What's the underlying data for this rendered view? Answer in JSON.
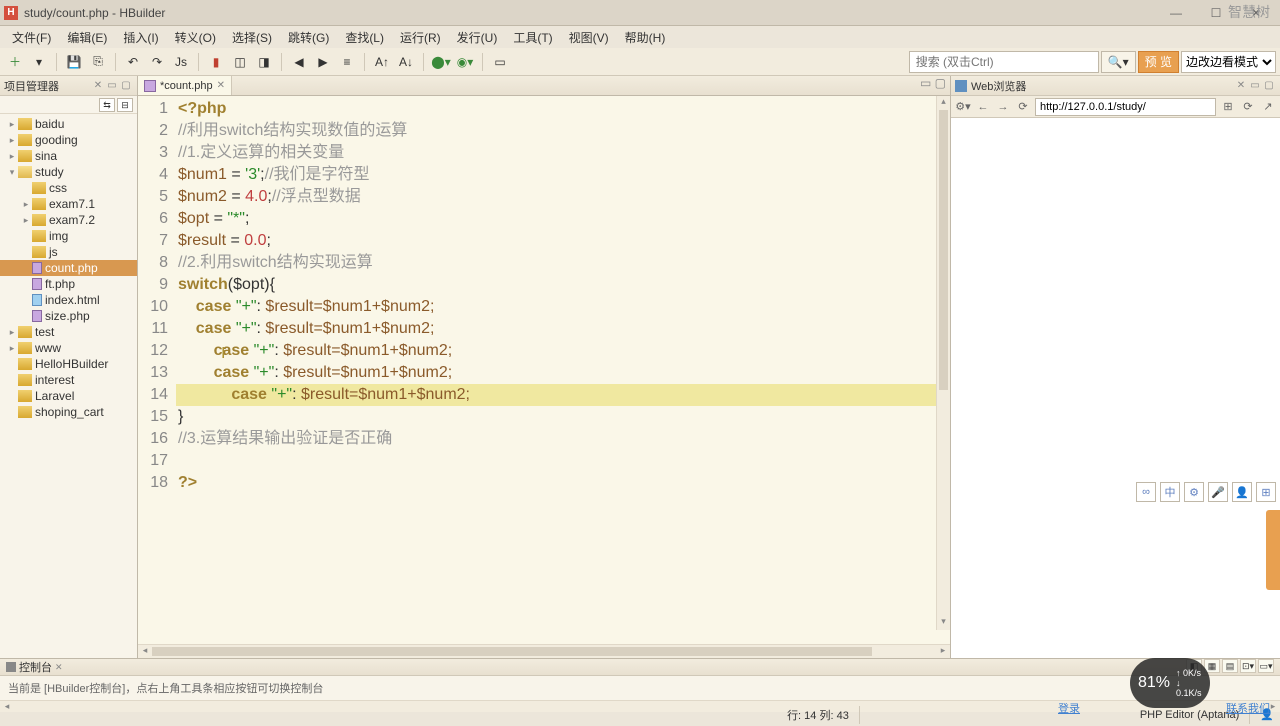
{
  "window": {
    "title": "study/count.php - HBuilder",
    "app_icon": "H",
    "watermark": "智慧树"
  },
  "menu": [
    "文件(F)",
    "编辑(E)",
    "插入(I)",
    "转义(O)",
    "选择(S)",
    "跳转(G)",
    "查找(L)",
    "运行(R)",
    "发行(U)",
    "工具(T)",
    "视图(V)",
    "帮助(H)"
  ],
  "toolbar": {
    "search_placeholder": "搜索 (双击Ctrl)",
    "preview_label": "预 览",
    "mode_label": "边改边看模式"
  },
  "project_manager": {
    "title": "项目管理器",
    "tree": [
      {
        "depth": 0,
        "exp": ">",
        "icon": "folder",
        "label": "baidu"
      },
      {
        "depth": 0,
        "exp": ">",
        "icon": "folder",
        "label": "gooding"
      },
      {
        "depth": 0,
        "exp": ">",
        "icon": "folder",
        "label": "sina"
      },
      {
        "depth": 0,
        "exp": "v",
        "icon": "folder-open",
        "label": "study"
      },
      {
        "depth": 1,
        "exp": " ",
        "icon": "folder",
        "label": "css"
      },
      {
        "depth": 1,
        "exp": ">",
        "icon": "folder",
        "label": "exam7.1"
      },
      {
        "depth": 1,
        "exp": ">",
        "icon": "folder",
        "label": "exam7.2"
      },
      {
        "depth": 1,
        "exp": " ",
        "icon": "folder",
        "label": "img"
      },
      {
        "depth": 1,
        "exp": " ",
        "icon": "folder",
        "label": "js"
      },
      {
        "depth": 1,
        "exp": " ",
        "icon": "php-ic",
        "label": "count.php",
        "selected": true
      },
      {
        "depth": 1,
        "exp": " ",
        "icon": "php-ic",
        "label": "ft.php"
      },
      {
        "depth": 1,
        "exp": " ",
        "icon": "html-ic",
        "label": "index.html"
      },
      {
        "depth": 1,
        "exp": " ",
        "icon": "php-ic",
        "label": "size.php"
      },
      {
        "depth": 0,
        "exp": ">",
        "icon": "folder",
        "label": "test"
      },
      {
        "depth": 0,
        "exp": ">",
        "icon": "folder",
        "label": "www"
      },
      {
        "depth": 0,
        "exp": " ",
        "icon": "folder",
        "label": "HelloHBuilder"
      },
      {
        "depth": 0,
        "exp": " ",
        "icon": "folder",
        "label": "interest"
      },
      {
        "depth": 0,
        "exp": " ",
        "icon": "folder",
        "label": "Laravel"
      },
      {
        "depth": 0,
        "exp": " ",
        "icon": "folder",
        "label": "shoping_cart"
      }
    ]
  },
  "editor": {
    "tab_label": "*count.php",
    "lines": 18,
    "code": {
      "l1": "<?php",
      "l2_c": "//利用switch结构实现数值的运算",
      "l3_c": "//1.定义运算的相关变量",
      "l4_var": "$num1",
      "l4_eq": " = ",
      "l4_str": "'3'",
      "l4_semi": ";",
      "l4_c": "//我们是字符型",
      "l5_var": "$num2",
      "l5_eq": " = ",
      "l5_num": "4.0",
      "l5_semi": ";",
      "l5_c": "//浮点型数据",
      "l6_var": "$opt",
      "l6_eq": " = ",
      "l6_str": "\"*\"",
      "l6_semi": ";",
      "l7_var": "$result",
      "l7_eq": " = ",
      "l7_num": "0.0",
      "l7_semi": ";",
      "l8_c": "//2.利用switch结构实现运算",
      "l9_kw": "switch",
      "l9_rest": "($opt){",
      "case_kw": "case",
      "case_str": "\"+\"",
      "colon": ": ",
      "assign": "$result=$num1+$num2;",
      "l15": "}",
      "l16_c": "//3.运算结果输出验证是否正确",
      "l18": "?>"
    }
  },
  "web_browser": {
    "title": "Web浏览器",
    "url": "http://127.0.0.1/study/"
  },
  "console": {
    "tab": "控制台",
    "text": "当前是 [HBuilder控制台]，点右上角工具条相应按钮可切换控制台"
  },
  "status": {
    "pos": "行: 14 列: 43",
    "editor": "PHP Editor (Aptana)",
    "login": "登录",
    "contact": "联系我们"
  },
  "overlay": {
    "cpu_pct": "81%",
    "cpu_sub1": "0K/s",
    "cpu_sub2": "0.1K/s"
  },
  "quick_access": [
    "∞",
    "中",
    "⚙",
    "🎤",
    "👤",
    "⊞"
  ]
}
